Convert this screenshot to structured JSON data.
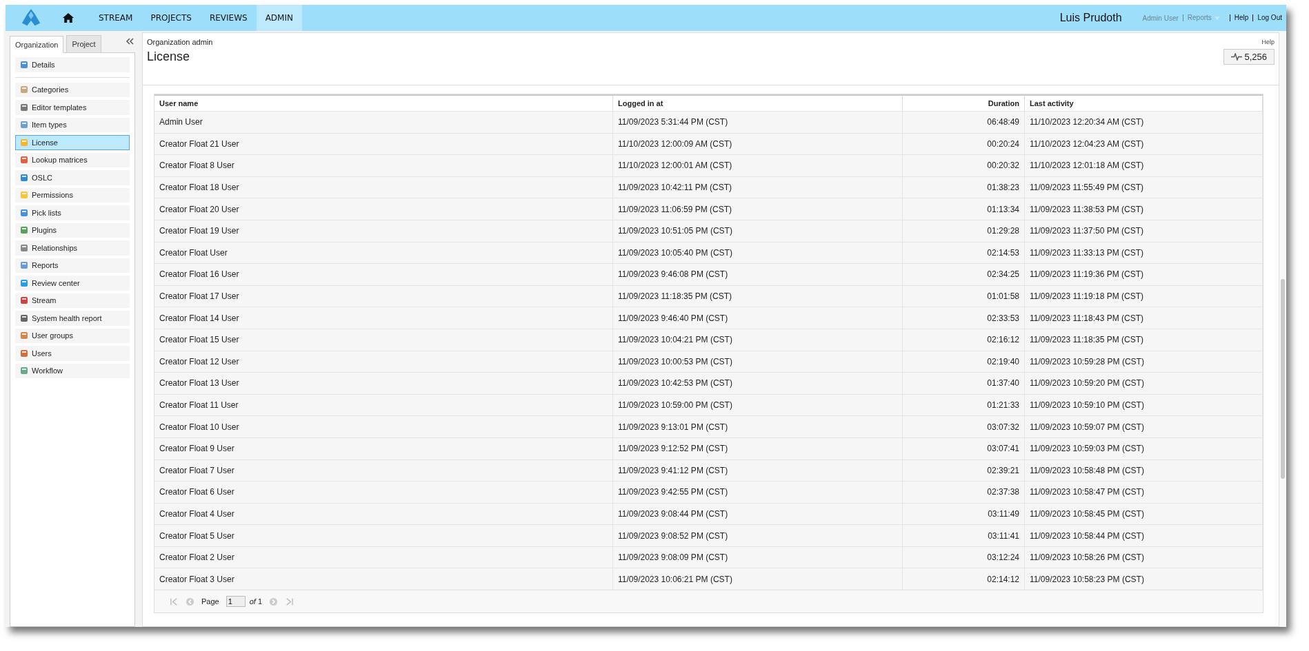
{
  "nav": {
    "items": [
      {
        "label": "STREAM",
        "selected": false
      },
      {
        "label": "PROJECTS",
        "selected": false
      },
      {
        "label": "REVIEWS",
        "selected": false
      },
      {
        "label": "ADMIN",
        "selected": true
      }
    ],
    "user": "Luis Prudoth",
    "links": [
      {
        "label": "Admin User",
        "kind": "muted"
      },
      {
        "label": "Reports",
        "kind": "menu"
      },
      {
        "label": "Help",
        "kind": "plain"
      },
      {
        "label": "Log Out",
        "kind": "plain"
      }
    ]
  },
  "sidebar": {
    "tabs": [
      {
        "label": "Organization",
        "selected": true
      },
      {
        "label": "Project",
        "selected": false
      }
    ],
    "groups": [
      [
        {
          "label": "Details",
          "selected": false
        }
      ],
      [
        {
          "label": "Categories",
          "selected": false
        },
        {
          "label": "Editor templates",
          "selected": false
        },
        {
          "label": "Item types",
          "selected": false
        },
        {
          "label": "License",
          "selected": true
        },
        {
          "label": "Lookup matrices",
          "selected": false
        },
        {
          "label": "OSLC",
          "selected": false
        },
        {
          "label": "Permissions",
          "selected": false
        },
        {
          "label": "Pick lists",
          "selected": false
        },
        {
          "label": "Plugins",
          "selected": false
        },
        {
          "label": "Relationships",
          "selected": false
        },
        {
          "label": "Reports",
          "selected": false
        },
        {
          "label": "Review center",
          "selected": false
        },
        {
          "label": "Stream",
          "selected": false
        },
        {
          "label": "System health report",
          "selected": false
        },
        {
          "label": "User groups",
          "selected": false
        },
        {
          "label": "Users",
          "selected": false
        },
        {
          "label": "Workflow",
          "selected": false
        }
      ]
    ]
  },
  "header": {
    "breadcrumb": "Organization admin",
    "help": "Help",
    "title": "License",
    "counter": "5,256"
  },
  "table": {
    "columns": [
      "User name",
      "Logged in at",
      "Duration",
      "Last activity"
    ],
    "rows": [
      [
        "Admin User",
        "11/09/2023 5:31:44 PM (CST)",
        "06:48:49",
        "11/10/2023 12:20:34 AM (CST)"
      ],
      [
        "Creator Float 21 User",
        "11/10/2023 12:00:09 AM (CST)",
        "00:20:24",
        "11/10/2023 12:04:23 AM (CST)"
      ],
      [
        "Creator Float 8 User",
        "11/10/2023 12:00:01 AM (CST)",
        "00:20:32",
        "11/10/2023 12:01:18 AM (CST)"
      ],
      [
        "Creator Float 18 User",
        "11/09/2023 10:42:11 PM (CST)",
        "01:38:23",
        "11/09/2023 11:55:49 PM (CST)"
      ],
      [
        "Creator Float 20 User",
        "11/09/2023 11:06:59 PM (CST)",
        "01:13:34",
        "11/09/2023 11:38:53 PM (CST)"
      ],
      [
        "Creator Float 19 User",
        "11/09/2023 10:51:05 PM (CST)",
        "01:29:28",
        "11/09/2023 11:37:50 PM (CST)"
      ],
      [
        "Creator Float User",
        "11/09/2023 10:05:40 PM (CST)",
        "02:14:53",
        "11/09/2023 11:33:13 PM (CST)"
      ],
      [
        "Creator Float 16 User",
        "11/09/2023 9:46:08 PM (CST)",
        "02:34:25",
        "11/09/2023 11:19:36 PM (CST)"
      ],
      [
        "Creator Float 17 User",
        "11/09/2023 11:18:35 PM (CST)",
        "01:01:58",
        "11/09/2023 11:19:18 PM (CST)"
      ],
      [
        "Creator Float 14 User",
        "11/09/2023 9:46:40 PM (CST)",
        "02:33:53",
        "11/09/2023 11:18:43 PM (CST)"
      ],
      [
        "Creator Float 15 User",
        "11/09/2023 10:04:21 PM (CST)",
        "02:16:12",
        "11/09/2023 11:18:35 PM (CST)"
      ],
      [
        "Creator Float 12 User",
        "11/09/2023 10:00:53 PM (CST)",
        "02:19:40",
        "11/09/2023 10:59:28 PM (CST)"
      ],
      [
        "Creator Float 13 User",
        "11/09/2023 10:42:53 PM (CST)",
        "01:37:40",
        "11/09/2023 10:59:20 PM (CST)"
      ],
      [
        "Creator Float 11 User",
        "11/09/2023 10:59:00 PM (CST)",
        "01:21:33",
        "11/09/2023 10:59:10 PM (CST)"
      ],
      [
        "Creator Float 10 User",
        "11/09/2023 9:13:01 PM (CST)",
        "03:07:32",
        "11/09/2023 10:59:07 PM (CST)"
      ],
      [
        "Creator Float 9 User",
        "11/09/2023 9:12:52 PM (CST)",
        "03:07:41",
        "11/09/2023 10:59:03 PM (CST)"
      ],
      [
        "Creator Float 7 User",
        "11/09/2023 9:41:12 PM (CST)",
        "02:39:21",
        "11/09/2023 10:58:48 PM (CST)"
      ],
      [
        "Creator Float 6 User",
        "11/09/2023 9:42:55 PM (CST)",
        "02:37:38",
        "11/09/2023 10:58:47 PM (CST)"
      ],
      [
        "Creator Float 4 User",
        "11/09/2023 9:08:44 PM (CST)",
        "03:11:49",
        "11/09/2023 10:58:45 PM (CST)"
      ],
      [
        "Creator Float 5 User",
        "11/09/2023 9:08:52 PM (CST)",
        "03:11:41",
        "11/09/2023 10:58:44 PM (CST)"
      ],
      [
        "Creator Float 2 User",
        "11/09/2023 9:08:09 PM (CST)",
        "03:12:24",
        "11/09/2023 10:58:26 PM (CST)"
      ],
      [
        "Creator Float 3 User",
        "11/09/2023 10:06:21 PM (CST)",
        "02:14:12",
        "11/09/2023 10:58:23 PM (CST)"
      ]
    ]
  },
  "pager": {
    "label": "Page",
    "value": "1",
    "total": "*of* 1"
  }
}
